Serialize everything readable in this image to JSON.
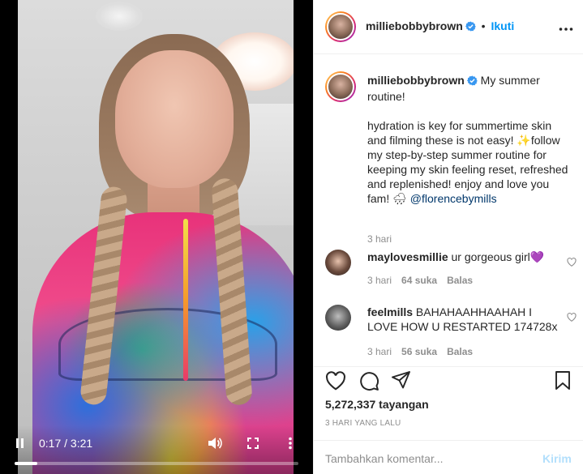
{
  "video": {
    "time_display": "0:17 / 3:21",
    "progress_fraction": 0.08
  },
  "post": {
    "author": "milliebobbybrown",
    "verified": true,
    "dot": "•",
    "follow_label": "Ikuti",
    "caption_title": "My summer routine!",
    "caption_body": "hydration is key for summertime skin and filming these is not easy! ✨follow my step-by-step summer routine for keeping my skin feeling reset, refreshed and replenished! enjoy and love you fam! 🌧 ",
    "caption_mention": "@florencebymills",
    "caption_age": "3 hari"
  },
  "comments": [
    {
      "username": "maylovesmillie",
      "text": "ur gorgeous girl💜",
      "age": "3 hari",
      "likes": "64 suka",
      "reply": "Balas"
    },
    {
      "username": "feelmills",
      "text": "BAHAHAAHHAAHAH I LOVE HOW U RESTARTED 174728x",
      "age": "3 hari",
      "likes": "56 suka",
      "reply": "Balas"
    }
  ],
  "stats": {
    "views": "5,272,337 tayangan",
    "date": "3 HARI YANG LALU"
  },
  "composer": {
    "placeholder": "Tambahkan komentar...",
    "post_label": "Kirim"
  },
  "colors": {
    "accent": "#0095f6",
    "post_disabled": "#b2dffc",
    "muted": "#8e8e8e",
    "mention": "#00376b"
  }
}
